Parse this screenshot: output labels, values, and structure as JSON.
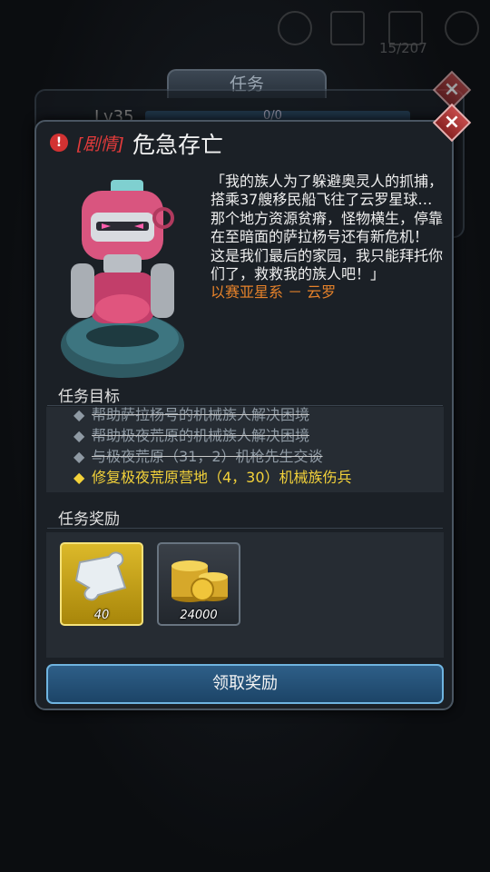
{
  "topbar": {
    "counter": "15/207"
  },
  "back_panel": {
    "tab_label": "任务",
    "level": "Lv35",
    "progress_text": "0/0"
  },
  "dialog": {
    "tag": "[剧情]",
    "title": "危急存亡",
    "story": [
      "「我的族人为了躲避奥灵人的抓捕，搭乘37艘移民船飞往了云罗星球…",
      "那个地方资源贫瘠，怪物横生，停靠在至暗面的萨拉杨号还有新危机！",
      "这是我们最后的家园，我只能拜托你们了，救救我的族人吧！」"
    ],
    "signature": "以赛亚星系 － 云罗",
    "objectives_title": "任务目标",
    "objectives": [
      {
        "text": "帮助萨拉杨号的机械族人解决困境",
        "state": "done"
      },
      {
        "text": "帮助极夜荒原的机械族人解决困境",
        "state": "done"
      },
      {
        "text": "与极夜荒原（31，2）机枪先生交谈",
        "state": "done"
      },
      {
        "text": "修复极夜荒原营地（4，30）机械族伤兵",
        "state": "active"
      }
    ],
    "rewards_title": "任务奖励",
    "rewards": [
      {
        "icon": "puzzle-piece-icon",
        "count": "40"
      },
      {
        "icon": "gold-coins-icon",
        "count": "24000"
      }
    ],
    "claim_label": "领取奖励"
  },
  "colors": {
    "accent_red": "#e33b3b",
    "active_objective": "#f3d23a",
    "signature": "#e6822a",
    "button": "#2e5f88"
  }
}
